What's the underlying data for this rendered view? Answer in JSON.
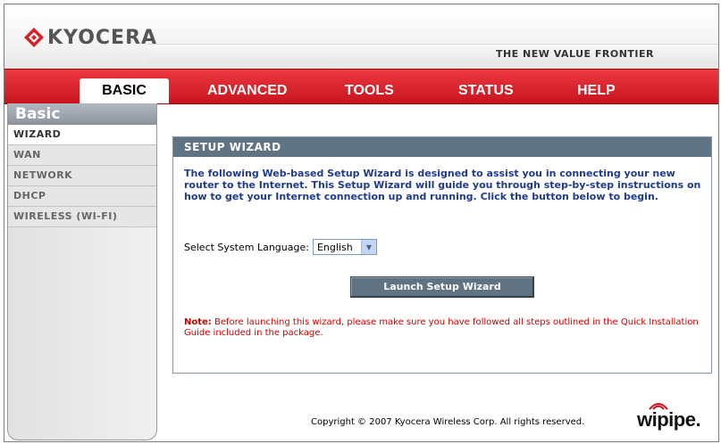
{
  "header": {
    "logo_text": "KYOCERA",
    "tagline": "THE NEW VALUE FRONTIER"
  },
  "nav": {
    "tabs": [
      {
        "label": "BASIC",
        "active": true
      },
      {
        "label": "ADVANCED"
      },
      {
        "label": "TOOLS"
      },
      {
        "label": "STATUS"
      },
      {
        "label": "HELP"
      }
    ]
  },
  "sidebar": {
    "title": "Basic",
    "items": [
      {
        "label": "WIZARD",
        "active": true
      },
      {
        "label": "WAN"
      },
      {
        "label": "NETWORK"
      },
      {
        "label": "DHCP"
      },
      {
        "label": "WIRELESS (WI-FI)"
      }
    ]
  },
  "panel": {
    "title": "SETUP WIZARD",
    "intro": "The following Web-based Setup Wizard is designed to assist you in connecting your new router to the Internet. This Setup Wizard will guide you through step-by-step instructions on how to get your Internet connection up and running. Click the button below to begin.",
    "language_label": "Select System Language:",
    "language_value": "English",
    "launch_label": "Launch Setup Wizard",
    "note_label": "Note:",
    "note_text": " Before launching this wizard, please make sure you have followed all steps outlined in the Quick Installation Guide included in the package."
  },
  "footer": {
    "copyright": "Copyright © 2007 Kyocera Wireless Corp. All rights reserved.",
    "brand": "wipipe."
  },
  "colors": {
    "nav_red": "#d4222a",
    "panel_header": "#5f7383",
    "intro_blue": "#1f3b8a",
    "note_red": "#cc0000",
    "brand_red": "#c8141c"
  }
}
